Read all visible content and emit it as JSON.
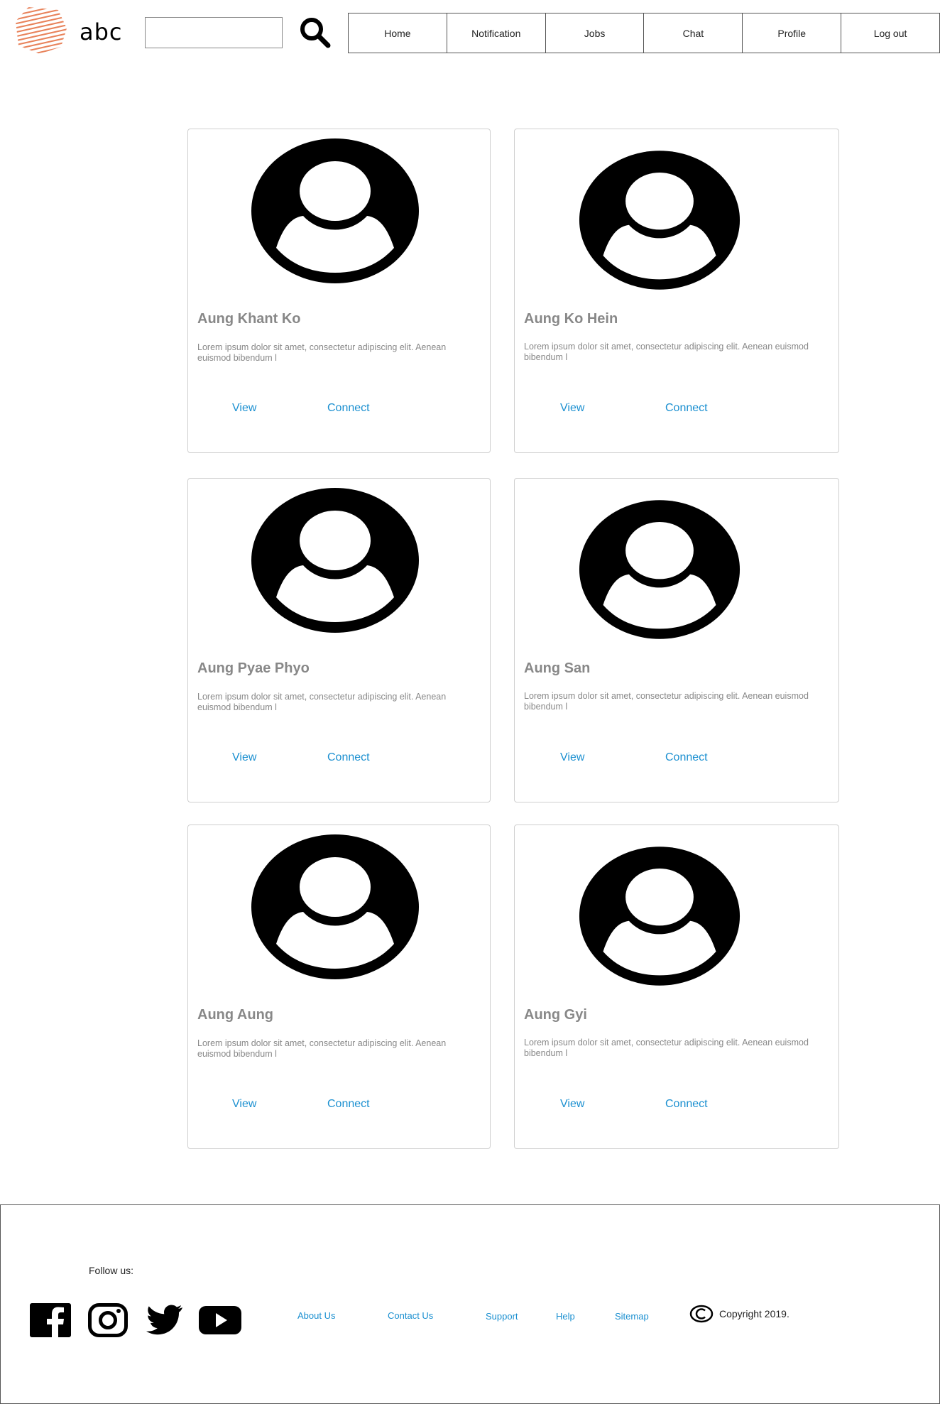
{
  "header": {
    "logo_text": "abc",
    "search": {
      "value": "",
      "placeholder": ""
    },
    "nav": [
      "Home",
      "Notification",
      "Jobs",
      "Chat",
      "Profile",
      "Log out"
    ]
  },
  "cards": [
    {
      "name": "Aung Khant Ko",
      "desc": "Lorem ipsum dolor sit amet, consectetur adipiscing elit. Aenean euismod bibendum l",
      "view": "View",
      "connect": "Connect"
    },
    {
      "name": "Aung Ko Hein",
      "desc": "Lorem ipsum dolor sit amet, consectetur adipiscing elit. Aenean euismod bibendum l",
      "view": "View",
      "connect": "Connect"
    },
    {
      "name": "Aung Pyae Phyo",
      "desc": "Lorem ipsum dolor sit amet, consectetur adipiscing elit. Aenean euismod bibendum l",
      "view": "View",
      "connect": "Connect"
    },
    {
      "name": "Aung San",
      "desc": "Lorem ipsum dolor sit amet, consectetur adipiscing elit. Aenean euismod bibendum l",
      "view": "View",
      "connect": "Connect"
    },
    {
      "name": "Aung Aung",
      "desc": "Lorem ipsum dolor sit amet, consectetur adipiscing elit. Aenean euismod bibendum l",
      "view": "View",
      "connect": "Connect"
    },
    {
      "name": "Aung Gyi",
      "desc": "Lorem ipsum dolor sit amet, consectetur adipiscing elit. Aenean euismod bibendum l",
      "view": "View",
      "connect": "Connect"
    }
  ],
  "footer": {
    "follow": "Follow us:",
    "social_icons": [
      "facebook-icon",
      "instagram-icon",
      "twitter-icon",
      "youtube-icon"
    ],
    "links": [
      "About Us",
      "Contact Us",
      "Support",
      "Help",
      "Sitemap"
    ],
    "copyright": "Copyright 2019."
  },
  "colors": {
    "link": "#1a8fd0",
    "logo": "#e8825a",
    "muted_text": "#888888"
  }
}
